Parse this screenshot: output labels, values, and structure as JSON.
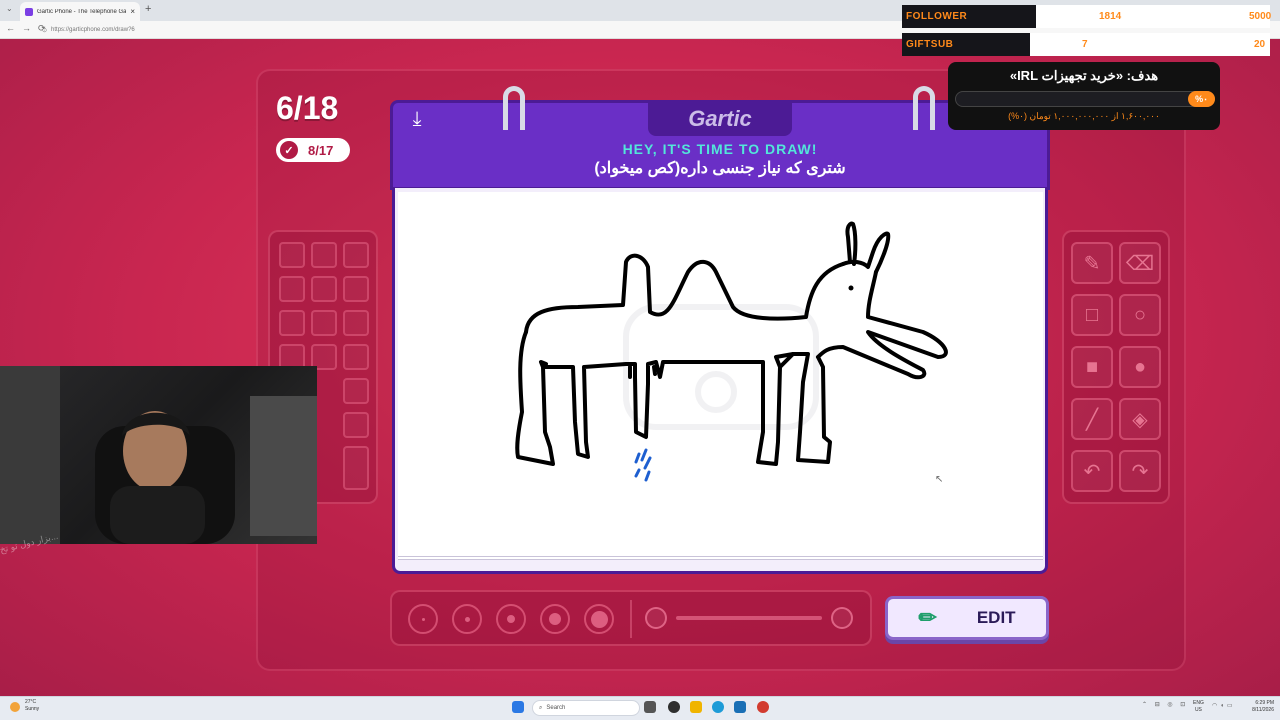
{
  "browser": {
    "tab_title": "Gartic Phone - The Telephone Gar",
    "tab_close": "×",
    "new_tab": "+",
    "url": "https://garticphone.com/draw?6"
  },
  "game": {
    "round_counter": "6/18",
    "done_count": "8/17",
    "brand": "Gartic",
    "prompt_title": "HEY, IT'S TIME TO DRAW!",
    "prompt_text": "شتری که نیاز جنسی داره(کص میخواد)",
    "edit_label": "EDIT"
  },
  "overlay": {
    "follower_label": "FOLLOWER",
    "follower_value": "1814",
    "follower_goal": "5000",
    "giftsub_label": "GIFTSUB",
    "giftsub_value": "7",
    "giftsub_goal": "20",
    "goal_title": "هدف: «خرید تجهیزات IRL»",
    "goal_percent": "%۰",
    "goal_sub": "۱,۶۰۰,۰۰۰ از ۱,۰۰۰,۰۰۰,۰۰۰ تومان (۰%)"
  },
  "webcam": {
    "caption": "بزار دول تو تخ..."
  },
  "taskbar": {
    "temp": "27°C",
    "condition": "Sunny",
    "search": "Search",
    "lang_top": "ENG",
    "lang_bottom": "US",
    "time": "6:29 PM",
    "date": "8/11/2026"
  },
  "colors": {
    "page_bg": "#c92650",
    "notebook_purple": "#6a2fc6",
    "prompt_title": "#53e6d9",
    "overlay_accent": "#ff8a1a",
    "edit_button": "#f1e8ff"
  },
  "icons": [
    "download-icon",
    "check-icon",
    "pencil-icon",
    "eraser-icon",
    "square-outline-icon",
    "circle-outline-icon",
    "square-fill-icon",
    "circle-fill-icon",
    "line-icon",
    "bucket-icon",
    "undo-icon",
    "redo-icon",
    "edit-pencil-icon",
    "search-icon"
  ]
}
